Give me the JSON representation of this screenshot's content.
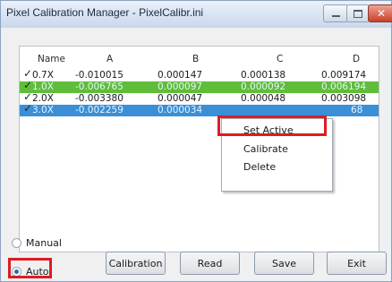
{
  "window": {
    "title": "Pixel Calibration Manager - PixelCalibr.ini"
  },
  "window_controls": {
    "minimize_icon": "minimize-icon",
    "maximize_icon": "maximize-icon",
    "close_icon": "close-icon",
    "close_glyph": "✕"
  },
  "list": {
    "columns": [
      "Name",
      "A",
      "B",
      "C",
      "D"
    ],
    "check_glyph": "✓",
    "rows": [
      {
        "name": "0.7X",
        "a": "-0.010015",
        "b": "0.000147",
        "c": "0.000138",
        "d": "0.009174",
        "state": "normal"
      },
      {
        "name": "1.0X",
        "a": "-0.006765",
        "b": "0.000097",
        "c": "0.000092",
        "d": "0.006194",
        "state": "active"
      },
      {
        "name": "2.0X",
        "a": "-0.003380",
        "b": "0.000047",
        "c": "0.000048",
        "d": "0.003098",
        "state": "normal"
      },
      {
        "name": "3.0X",
        "a": "-0.002259",
        "b": "0.000034",
        "c": "",
        "d": "68",
        "state": "selected"
      }
    ]
  },
  "context_menu": {
    "items": [
      "Set Active",
      "Calibrate",
      "Delete"
    ]
  },
  "mode": {
    "manual_label": "Manual",
    "auto_label": "Auto",
    "selected": "Auto"
  },
  "buttons": {
    "calibration": "Calibration",
    "read": "Read",
    "save": "Save",
    "exit": "Exit"
  },
  "colors": {
    "active_row": "#5fbd3a",
    "selected_row": "#3a8fd6",
    "highlight": "#dc1c24"
  }
}
